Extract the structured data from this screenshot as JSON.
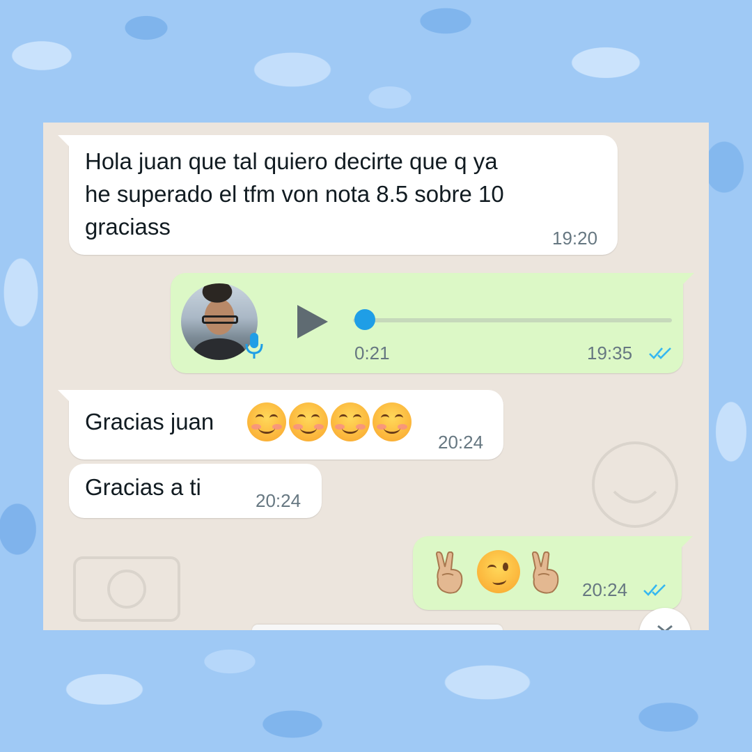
{
  "chat": {
    "messages": [
      {
        "direction": "incoming",
        "text_line1": "Hola juan que tal quiero decirte que q ya",
        "text_line2": "he superado el tfm von nota 8.5 sobre 10",
        "text_line3": "graciass",
        "time": "19:20"
      },
      {
        "direction": "outgoing",
        "type": "voice-note",
        "duration": "0:21",
        "time": "19:35",
        "status": "read",
        "progress": 0
      },
      {
        "direction": "incoming",
        "text": "Gracias juan",
        "emoji": [
          "smiling-face-with-smiling-eyes",
          "smiling-face-with-smiling-eyes",
          "smiling-face-with-smiling-eyes",
          "smiling-face-with-smiling-eyes"
        ],
        "time": "20:24"
      },
      {
        "direction": "incoming",
        "text": "Gracias  a ti",
        "time": "20:24"
      },
      {
        "direction": "outgoing",
        "emoji": [
          "victory-hand",
          "winking-face",
          "victory-hand"
        ],
        "time": "20:24",
        "status": "read"
      }
    ]
  },
  "colors": {
    "incoming_bubble": "#ffffff",
    "outgoing_bubble": "#dcf8c6",
    "chat_background": "#ece5dd",
    "read_ticks": "#34b7f1",
    "voice_progress_dot": "#1f9ee6",
    "page_background": "#9fc9f5"
  },
  "icons": {
    "play": "play-icon",
    "mic": "mic-icon",
    "ticks": "double-check-icon",
    "scroll": "chevron-down-icon"
  }
}
